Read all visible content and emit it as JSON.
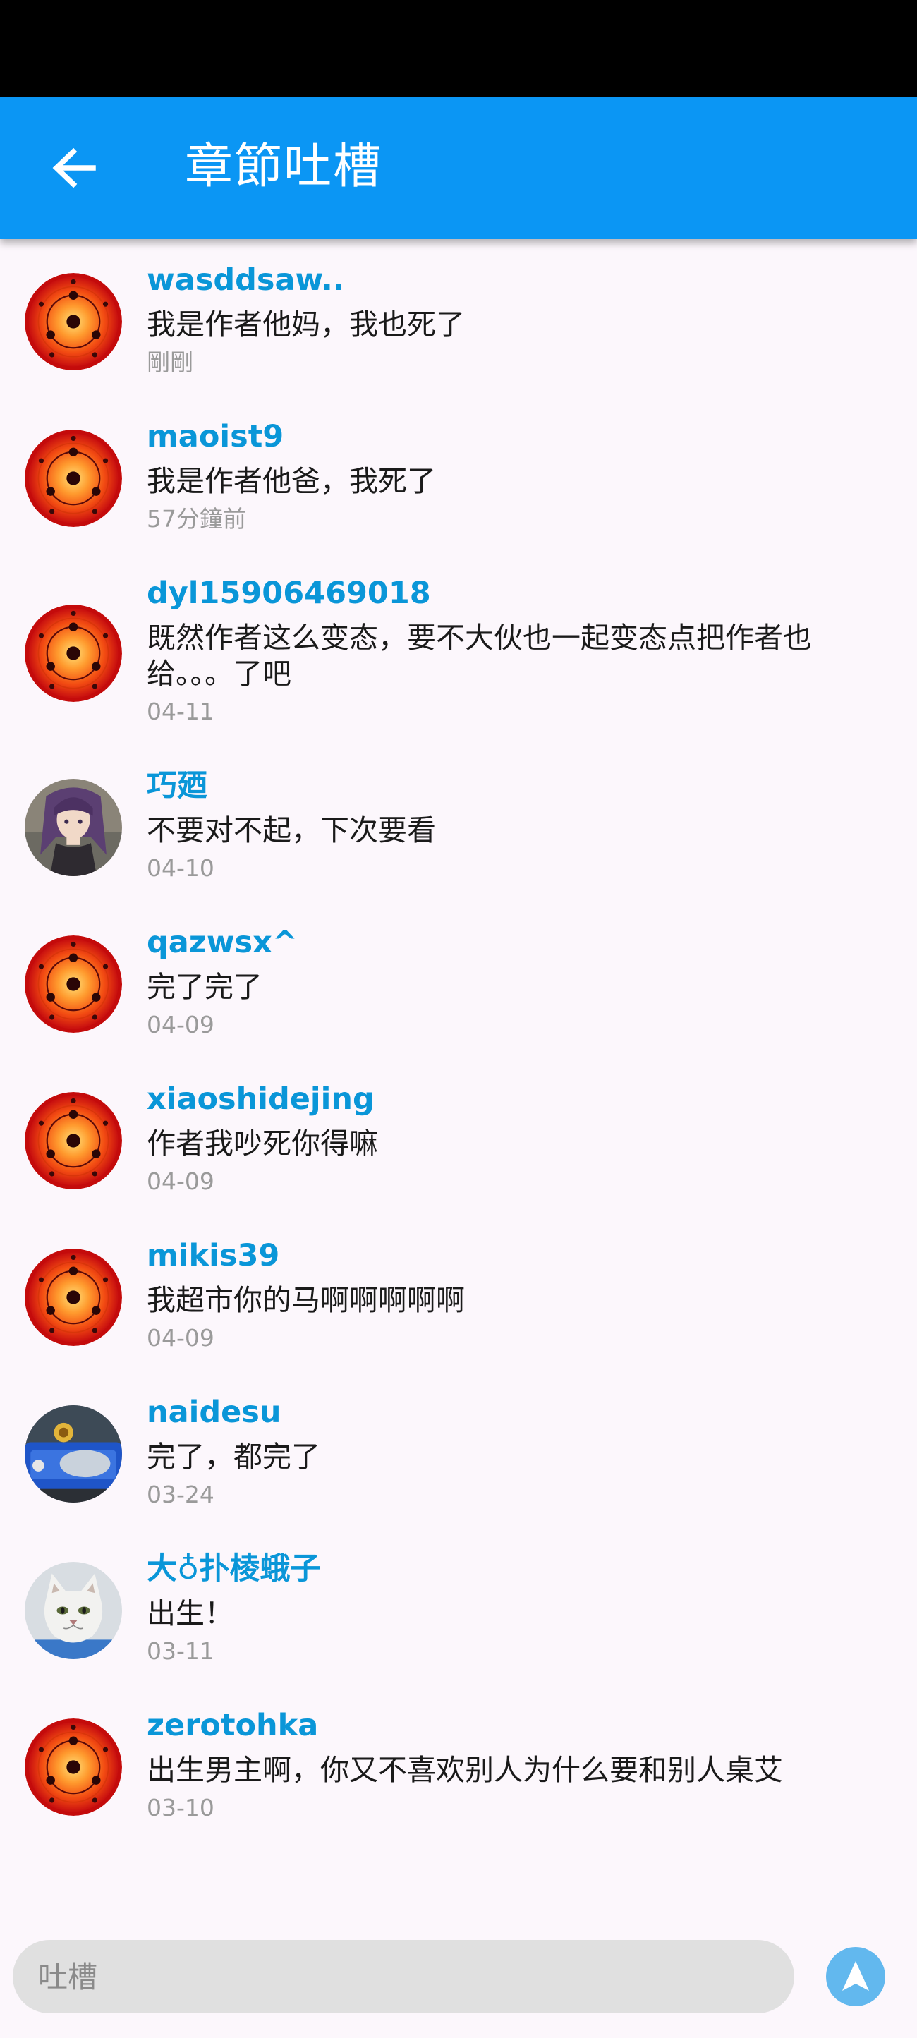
{
  "header": {
    "title": "章節吐槽"
  },
  "comments": [
    {
      "username": "wasddsaw..",
      "text": "我是作者他妈，我也死了",
      "time": "剛剛",
      "avatar": "sharingan-avatar"
    },
    {
      "username": "maoist9",
      "text": "我是作者他爸，我死了",
      "time": "57分鐘前",
      "avatar": "sharingan-avatar"
    },
    {
      "username": "dyl15906469018",
      "text": "既然作者这么变态，要不大伙也一起变态点把作者也给。。。了吧",
      "time": "04-11",
      "avatar": "sharingan-avatar"
    },
    {
      "username": "巧廼",
      "text": "不要对不起，下次要看",
      "time": "04-10",
      "avatar": "anime-girl-avatar"
    },
    {
      "username": "qazwsx^",
      "text": "完了完了",
      "time": "04-09",
      "avatar": "sharingan-avatar"
    },
    {
      "username": "xiaoshidejing",
      "text": "作者我吵死你得嘛",
      "time": "04-09",
      "avatar": "sharingan-avatar"
    },
    {
      "username": "mikis39",
      "text": "我超市你的马啊啊啊啊啊",
      "time": "04-09",
      "avatar": "sharingan-avatar"
    },
    {
      "username": "naidesu",
      "text": "完了，都完了",
      "time": "03-24",
      "avatar": "robot-avatar"
    },
    {
      "username": "大♁扑棱蛾子",
      "text": "出生！",
      "time": "03-11",
      "avatar": "cat-avatar"
    },
    {
      "username": "zerotohka",
      "text": "出生男主啊，你又不喜欢别人为什么要和别人桌艾",
      "time": "03-10",
      "avatar": "sharingan-avatar"
    }
  ],
  "input": {
    "placeholder": "吐槽"
  },
  "colors": {
    "app_bar": "#0b96f4",
    "username": "#0a96d8",
    "send_button": "#62b8ee",
    "input_background": "#e0e0e0"
  },
  "icons": {
    "back": "arrow-left-icon",
    "send": "navigation-arrow-icon"
  }
}
